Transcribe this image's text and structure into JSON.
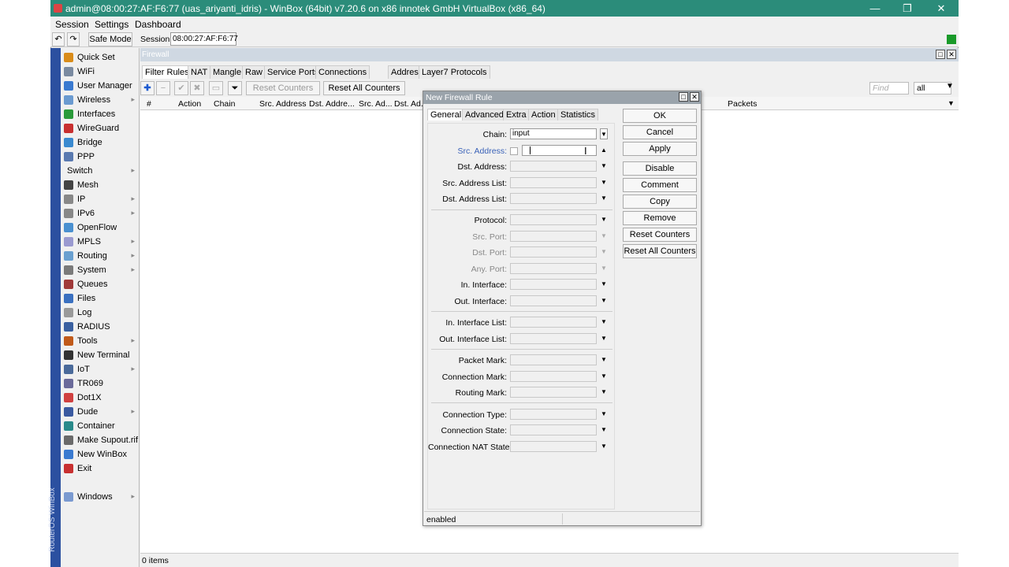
{
  "window": {
    "title": "admin@08:00:27:AF:F6:77 (uas_ariyanti_idris) - WinBox (64bit) v7.20.6 on x86 innotek GmbH VirtualBox (x86_64)",
    "minimize": "—",
    "restore": "❐",
    "close": "✕"
  },
  "menu": [
    "Session",
    "Settings",
    "Dashboard"
  ],
  "toolbar": {
    "undo": "↶",
    "redo": "↷",
    "safe_mode": "Safe Mode",
    "session_label": "Session:",
    "session_value": "08:00:27:AF:F6:77"
  },
  "sidebar": {
    "vertical_text": "RouterOS WinBox",
    "items": [
      {
        "label": "Quick Set",
        "color": "#d98c1a",
        "arrow": ""
      },
      {
        "label": "WiFi",
        "color": "#7a8aa0",
        "arrow": ""
      },
      {
        "label": "User Manager",
        "color": "#3a7ad0",
        "arrow": ""
      },
      {
        "label": "Wireless",
        "color": "#6a9ad0",
        "arrow": "▸"
      },
      {
        "label": "Interfaces",
        "color": "#2a9a3a",
        "arrow": ""
      },
      {
        "label": "WireGuard",
        "color": "#c83030",
        "arrow": ""
      },
      {
        "label": "Bridge",
        "color": "#3a8ad0",
        "arrow": ""
      },
      {
        "label": "PPP",
        "color": "#5a7ab0",
        "arrow": ""
      },
      {
        "label": "Switch",
        "color": "",
        "arrow": "▸"
      },
      {
        "label": "Mesh",
        "color": "#444444",
        "arrow": ""
      },
      {
        "label": "IP",
        "color": "#888888",
        "arrow": "▸"
      },
      {
        "label": "IPv6",
        "color": "#888888",
        "arrow": "▸"
      },
      {
        "label": "OpenFlow",
        "color": "#4a90d0",
        "arrow": ""
      },
      {
        "label": "MPLS",
        "color": "#9a9ad0",
        "arrow": "▸"
      },
      {
        "label": "Routing",
        "color": "#6aa0d0",
        "arrow": "▸"
      },
      {
        "label": "System",
        "color": "#7a7a7a",
        "arrow": "▸"
      },
      {
        "label": "Queues",
        "color": "#a03a3a",
        "arrow": ""
      },
      {
        "label": "Files",
        "color": "#3a70c0",
        "arrow": ""
      },
      {
        "label": "Log",
        "color": "#9a9a9a",
        "arrow": ""
      },
      {
        "label": "RADIUS",
        "color": "#3a60a0",
        "arrow": ""
      },
      {
        "label": "Tools",
        "color": "#c05a1a",
        "arrow": "▸"
      },
      {
        "label": "New Terminal",
        "color": "#333333",
        "arrow": ""
      },
      {
        "label": "IoT",
        "color": "#4a6a9a",
        "arrow": "▸"
      },
      {
        "label": "TR069",
        "color": "#6a6a9a",
        "arrow": ""
      },
      {
        "label": "Dot1X",
        "color": "#d04040",
        "arrow": ""
      },
      {
        "label": "Dude",
        "color": "#3a5aa0",
        "arrow": "▸"
      },
      {
        "label": "Container",
        "color": "#2a8a8a",
        "arrow": ""
      },
      {
        "label": "Make Supout.rif",
        "color": "#6a6a6a",
        "arrow": ""
      },
      {
        "label": "New WinBox",
        "color": "#3a7ad0",
        "arrow": ""
      },
      {
        "label": "Exit",
        "color": "#c83030",
        "arrow": ""
      },
      {
        "label": "Windows",
        "color": "#7a9ad0",
        "arrow": "▸"
      }
    ]
  },
  "firewall": {
    "title": "Firewall",
    "tabs": [
      "Filter Rules",
      "NAT",
      "Mangle",
      "Raw",
      "Service Ports",
      "Connections",
      "Address Lists",
      "Layer7 Protocols"
    ],
    "reset_counters": "Reset Counters",
    "reset_all_counters": "Reset All Counters",
    "find_placeholder": "Find",
    "filter_value": "all",
    "columns": [
      "#",
      "Action",
      "Chain",
      "Src. Address",
      "Dst. Addre...",
      "Src. Ad...",
      "Dst. Ad...",
      "Packets"
    ],
    "status": "0 items"
  },
  "dialog": {
    "title": "New Firewall Rule",
    "tabs": [
      "General",
      "Advanced",
      "Extra",
      "Action",
      "Statistics"
    ],
    "fields": {
      "chain": {
        "label": "Chain:",
        "value": "input"
      },
      "src_address": {
        "label": "Src. Address:",
        "value": ""
      },
      "dst_address": {
        "label": "Dst. Address:",
        "value": ""
      },
      "src_address_list": {
        "label": "Src. Address List:",
        "value": ""
      },
      "dst_address_list": {
        "label": "Dst. Address List:",
        "value": ""
      },
      "protocol": {
        "label": "Protocol:",
        "value": ""
      },
      "src_port": {
        "label": "Src. Port:",
        "value": ""
      },
      "dst_port": {
        "label": "Dst. Port:",
        "value": ""
      },
      "any_port": {
        "label": "Any. Port:",
        "value": ""
      },
      "in_interface": {
        "label": "In. Interface:",
        "value": ""
      },
      "out_interface": {
        "label": "Out. Interface:",
        "value": ""
      },
      "in_interface_list": {
        "label": "In. Interface List:",
        "value": ""
      },
      "out_interface_list": {
        "label": "Out. Interface List:",
        "value": ""
      },
      "packet_mark": {
        "label": "Packet Mark:",
        "value": ""
      },
      "connection_mark": {
        "label": "Connection Mark:",
        "value": ""
      },
      "routing_mark": {
        "label": "Routing Mark:",
        "value": ""
      },
      "connection_type": {
        "label": "Connection Type:",
        "value": ""
      },
      "connection_state": {
        "label": "Connection State:",
        "value": ""
      },
      "connection_nat_state": {
        "label": "Connection NAT State:",
        "value": ""
      }
    },
    "buttons": [
      "OK",
      "Cancel",
      "Apply",
      "Disable",
      "Comment",
      "Copy",
      "Remove",
      "Reset Counters",
      "Reset All Counters"
    ],
    "status": "enabled"
  }
}
